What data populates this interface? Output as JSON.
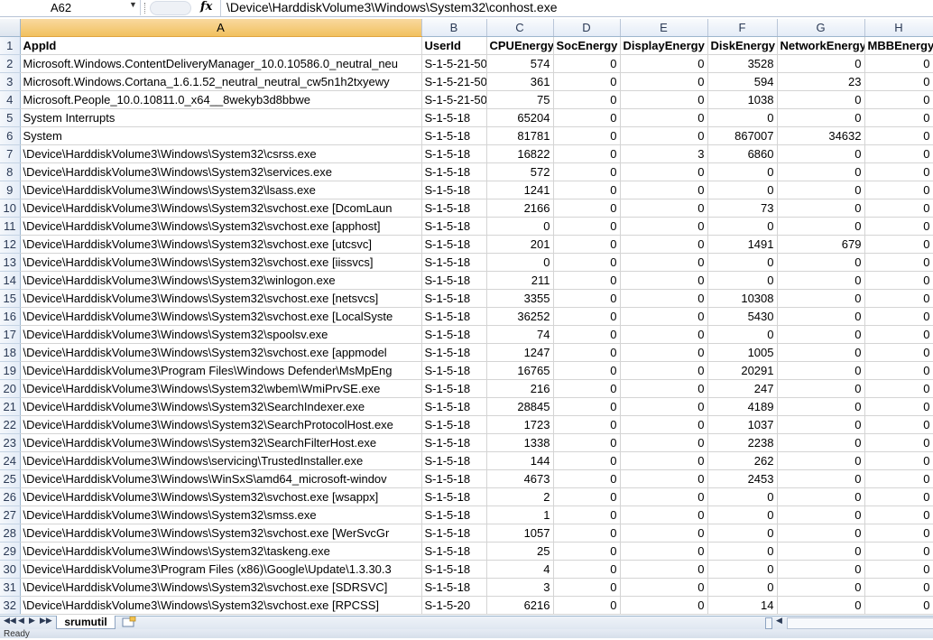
{
  "formula_bar": {
    "name_box": "A62",
    "fx": "fx",
    "formula": "\\Device\\HarddiskVolume3\\Windows\\System32\\conhost.exe"
  },
  "columns": [
    "A",
    "B",
    "C",
    "D",
    "E",
    "F",
    "G",
    "H"
  ],
  "selected_column": "A",
  "rows": [
    {
      "n": "1",
      "cells": [
        "AppId",
        "UserId",
        "CPUEnergy",
        "SocEnergy",
        "DisplayEnergy",
        "DiskEnergy",
        "NetworkEnergy",
        "MBBEnergy"
      ]
    },
    {
      "n": "2",
      "cells": [
        "Microsoft.Windows.ContentDeliveryManager_10.0.10586.0_neutral_neu",
        "S-1-5-21-50",
        "574",
        "0",
        "0",
        "3528",
        "0",
        "0"
      ]
    },
    {
      "n": "3",
      "cells": [
        "Microsoft.Windows.Cortana_1.6.1.52_neutral_neutral_cw5n1h2txyewy",
        "S-1-5-21-50",
        "361",
        "0",
        "0",
        "594",
        "23",
        "0"
      ]
    },
    {
      "n": "4",
      "cells": [
        "Microsoft.People_10.0.10811.0_x64__8wekyb3d8bbwe",
        "S-1-5-21-50",
        "75",
        "0",
        "0",
        "1038",
        "0",
        "0"
      ]
    },
    {
      "n": "5",
      "cells": [
        "System Interrupts",
        "S-1-5-18",
        "65204",
        "0",
        "0",
        "0",
        "0",
        "0"
      ]
    },
    {
      "n": "6",
      "cells": [
        "System",
        "S-1-5-18",
        "81781",
        "0",
        "0",
        "867007",
        "34632",
        "0"
      ]
    },
    {
      "n": "7",
      "cells": [
        "\\Device\\HarddiskVolume3\\Windows\\System32\\csrss.exe",
        "S-1-5-18",
        "16822",
        "0",
        "3",
        "6860",
        "0",
        "0"
      ]
    },
    {
      "n": "8",
      "cells": [
        "\\Device\\HarddiskVolume3\\Windows\\System32\\services.exe",
        "S-1-5-18",
        "572",
        "0",
        "0",
        "0",
        "0",
        "0"
      ]
    },
    {
      "n": "9",
      "cells": [
        "\\Device\\HarddiskVolume3\\Windows\\System32\\lsass.exe",
        "S-1-5-18",
        "1241",
        "0",
        "0",
        "0",
        "0",
        "0"
      ]
    },
    {
      "n": "10",
      "cells": [
        "\\Device\\HarddiskVolume3\\Windows\\System32\\svchost.exe [DcomLaun",
        "S-1-5-18",
        "2166",
        "0",
        "0",
        "73",
        "0",
        "0"
      ]
    },
    {
      "n": "11",
      "cells": [
        "\\Device\\HarddiskVolume3\\Windows\\System32\\svchost.exe [apphost]",
        "S-1-5-18",
        "0",
        "0",
        "0",
        "0",
        "0",
        "0"
      ]
    },
    {
      "n": "12",
      "cells": [
        "\\Device\\HarddiskVolume3\\Windows\\System32\\svchost.exe [utcsvc]",
        "S-1-5-18",
        "201",
        "0",
        "0",
        "1491",
        "679",
        "0"
      ]
    },
    {
      "n": "13",
      "cells": [
        "\\Device\\HarddiskVolume3\\Windows\\System32\\svchost.exe [iissvcs]",
        "S-1-5-18",
        "0",
        "0",
        "0",
        "0",
        "0",
        "0"
      ]
    },
    {
      "n": "14",
      "cells": [
        "\\Device\\HarddiskVolume3\\Windows\\System32\\winlogon.exe",
        "S-1-5-18",
        "211",
        "0",
        "0",
        "0",
        "0",
        "0"
      ]
    },
    {
      "n": "15",
      "cells": [
        "\\Device\\HarddiskVolume3\\Windows\\System32\\svchost.exe [netsvcs]",
        "S-1-5-18",
        "3355",
        "0",
        "0",
        "10308",
        "0",
        "0"
      ]
    },
    {
      "n": "16",
      "cells": [
        "\\Device\\HarddiskVolume3\\Windows\\System32\\svchost.exe [LocalSyste",
        "S-1-5-18",
        "36252",
        "0",
        "0",
        "5430",
        "0",
        "0"
      ]
    },
    {
      "n": "17",
      "cells": [
        "\\Device\\HarddiskVolume3\\Windows\\System32\\spoolsv.exe",
        "S-1-5-18",
        "74",
        "0",
        "0",
        "0",
        "0",
        "0"
      ]
    },
    {
      "n": "18",
      "cells": [
        "\\Device\\HarddiskVolume3\\Windows\\System32\\svchost.exe [appmodel",
        "S-1-5-18",
        "1247",
        "0",
        "0",
        "1005",
        "0",
        "0"
      ]
    },
    {
      "n": "19",
      "cells": [
        "\\Device\\HarddiskVolume3\\Program Files\\Windows Defender\\MsMpEng",
        "S-1-5-18",
        "16765",
        "0",
        "0",
        "20291",
        "0",
        "0"
      ]
    },
    {
      "n": "20",
      "cells": [
        "\\Device\\HarddiskVolume3\\Windows\\System32\\wbem\\WmiPrvSE.exe",
        "S-1-5-18",
        "216",
        "0",
        "0",
        "247",
        "0",
        "0"
      ]
    },
    {
      "n": "21",
      "cells": [
        "\\Device\\HarddiskVolume3\\Windows\\System32\\SearchIndexer.exe",
        "S-1-5-18",
        "28845",
        "0",
        "0",
        "4189",
        "0",
        "0"
      ]
    },
    {
      "n": "22",
      "cells": [
        "\\Device\\HarddiskVolume3\\Windows\\System32\\SearchProtocolHost.exe",
        "S-1-5-18",
        "1723",
        "0",
        "0",
        "1037",
        "0",
        "0"
      ]
    },
    {
      "n": "23",
      "cells": [
        "\\Device\\HarddiskVolume3\\Windows\\System32\\SearchFilterHost.exe",
        "S-1-5-18",
        "1338",
        "0",
        "0",
        "2238",
        "0",
        "0"
      ]
    },
    {
      "n": "24",
      "cells": [
        "\\Device\\HarddiskVolume3\\Windows\\servicing\\TrustedInstaller.exe",
        "S-1-5-18",
        "144",
        "0",
        "0",
        "262",
        "0",
        "0"
      ]
    },
    {
      "n": "25",
      "cells": [
        "\\Device\\HarddiskVolume3\\Windows\\WinSxS\\amd64_microsoft-windov",
        "S-1-5-18",
        "4673",
        "0",
        "0",
        "2453",
        "0",
        "0"
      ]
    },
    {
      "n": "26",
      "cells": [
        "\\Device\\HarddiskVolume3\\Windows\\System32\\svchost.exe [wsappx]",
        "S-1-5-18",
        "2",
        "0",
        "0",
        "0",
        "0",
        "0"
      ]
    },
    {
      "n": "27",
      "cells": [
        "\\Device\\HarddiskVolume3\\Windows\\System32\\smss.exe",
        "S-1-5-18",
        "1",
        "0",
        "0",
        "0",
        "0",
        "0"
      ]
    },
    {
      "n": "28",
      "cells": [
        "\\Device\\HarddiskVolume3\\Windows\\System32\\svchost.exe [WerSvcGr",
        "S-1-5-18",
        "1057",
        "0",
        "0",
        "0",
        "0",
        "0"
      ]
    },
    {
      "n": "29",
      "cells": [
        "\\Device\\HarddiskVolume3\\Windows\\System32\\taskeng.exe",
        "S-1-5-18",
        "25",
        "0",
        "0",
        "0",
        "0",
        "0"
      ]
    },
    {
      "n": "30",
      "cells": [
        "\\Device\\HarddiskVolume3\\Program Files (x86)\\Google\\Update\\1.3.30.3",
        "S-1-5-18",
        "4",
        "0",
        "0",
        "0",
        "0",
        "0"
      ]
    },
    {
      "n": "31",
      "cells": [
        "\\Device\\HarddiskVolume3\\Windows\\System32\\svchost.exe [SDRSVC]",
        "S-1-5-18",
        "3",
        "0",
        "0",
        "0",
        "0",
        "0"
      ]
    },
    {
      "n": "32",
      "cells": [
        "\\Device\\HarddiskVolume3\\Windows\\System32\\svchost.exe [RPCSS]",
        "S-1-5-20",
        "6216",
        "0",
        "0",
        "14",
        "0",
        "0"
      ]
    }
  ],
  "sheet_tabs": [
    {
      "label": "srumutil",
      "active": true
    }
  ],
  "status": "Ready",
  "icons": {
    "name_box_dropdown": "chevron-down-icon",
    "function": "fx-icon",
    "tab_nav": [
      "first-sheet-icon",
      "prev-sheet-icon",
      "next-sheet-icon",
      "last-sheet-icon"
    ],
    "new_sheet": "new-sheet-icon"
  },
  "colors": {
    "header_bg": "#e4ecf7",
    "selected_header": "#f1c15f",
    "gridline": "#d4d4d4"
  }
}
